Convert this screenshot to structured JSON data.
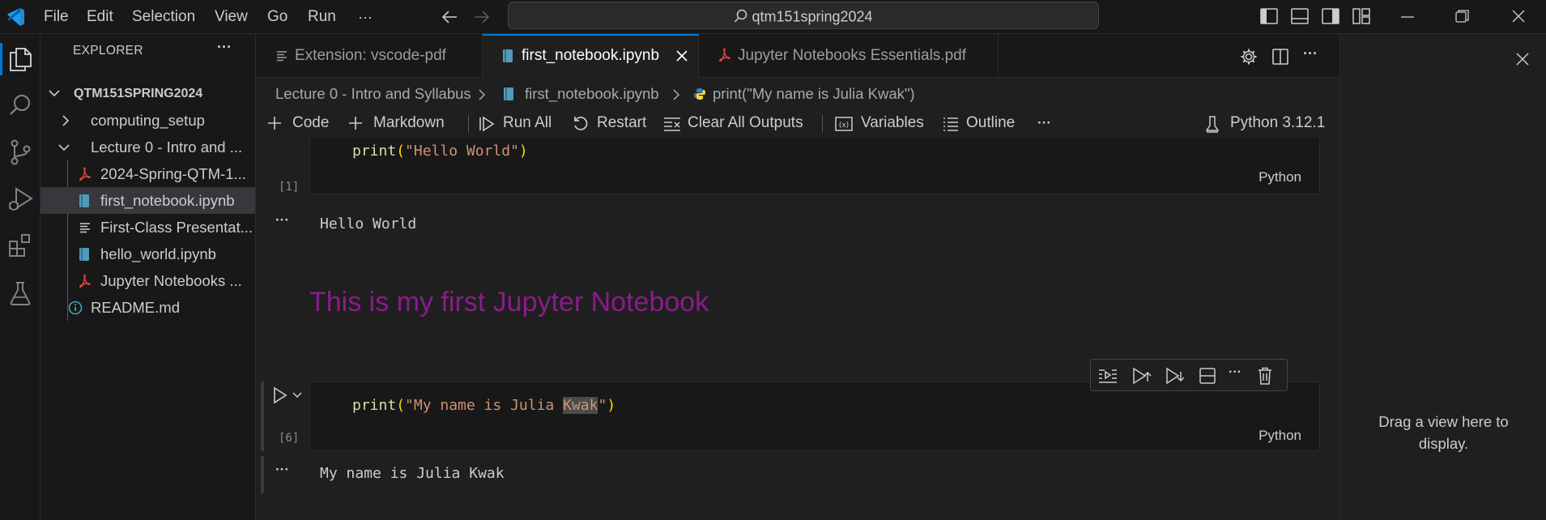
{
  "titlebar": {
    "menu": [
      "File",
      "Edit",
      "Selection",
      "View",
      "Go",
      "Run"
    ],
    "more": "···",
    "search_text": "qtm151spring2024"
  },
  "explorer": {
    "title": "EXPLORER",
    "more": "···",
    "root": "QTM151SPRING2024",
    "items": [
      {
        "label": "computing_setup",
        "kind": "folder-collapsed"
      },
      {
        "label": "Lecture 0 - Intro and ...",
        "kind": "folder-open"
      },
      {
        "label": "2024-Spring-QTM-1...",
        "kind": "pdf"
      },
      {
        "label": "first_notebook.ipynb",
        "kind": "notebook"
      },
      {
        "label": "First-Class Presentat...",
        "kind": "text"
      },
      {
        "label": "hello_world.ipynb",
        "kind": "notebook"
      },
      {
        "label": "Jupyter Notebooks ...",
        "kind": "pdf"
      },
      {
        "label": "README.md",
        "kind": "info"
      }
    ]
  },
  "tabs": [
    {
      "label": "Extension: vscode-pdf",
      "active": false
    },
    {
      "label": "first_notebook.ipynb",
      "active": true
    },
    {
      "label": "Jupyter Notebooks Essentials.pdf",
      "active": false
    }
  ],
  "breadcrumb": {
    "folder": "Lecture 0 - Intro and Syllabus",
    "file": "first_notebook.ipynb",
    "symbol": "print(\"My name is Julia Kwak\")"
  },
  "notebook_toolbar": {
    "code": "Code",
    "markdown": "Markdown",
    "run_all": "Run All",
    "restart": "Restart",
    "clear": "Clear All Outputs",
    "variables": "Variables",
    "outline": "Outline",
    "more": "···",
    "kernel": "Python 3.12.1"
  },
  "cells": {
    "cell1": {
      "func": "print",
      "open": "(",
      "str": "\"Hello World\"",
      "close": ")",
      "exec": "[1]",
      "lang": "Python",
      "output": "Hello World"
    },
    "markdown": {
      "text": "This is my first Jupyter Notebook"
    },
    "cell2": {
      "func": "print",
      "open": "(",
      "str_a": "\"My name is Julia ",
      "str_sel": "Kwak",
      "str_b": "\"",
      "close": ")",
      "exec": "[6]",
      "lang": "Python",
      "output": "My name is Julia Kwak"
    },
    "output_more": "···"
  },
  "right_panel": {
    "text": "Drag a view here to display."
  },
  "colors": {
    "accent": "#0078d4",
    "markdown_heading": "#8a1c8a",
    "string": "#ce9178",
    "function": "#dcdcaa",
    "paren": "#ffd700"
  }
}
